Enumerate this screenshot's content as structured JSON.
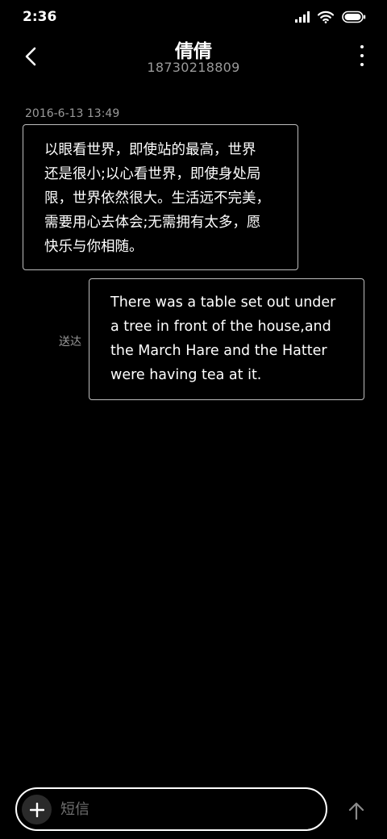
{
  "status_bar": {
    "time": "2:36",
    "icons": [
      "signal-icon",
      "wifi-icon",
      "battery-icon"
    ]
  },
  "header": {
    "contact_name": "倩倩",
    "phone_number": "18730218809",
    "icons": [
      "back-arrow-icon",
      "more-vertical-icon"
    ]
  },
  "conversation": {
    "timestamp": "2016-6-13 13:49",
    "messages": [
      {
        "direction": "incoming",
        "lines": [
          "以眼看世界，即使站的最高，世界",
          "还是很小;以心看世界，即使身处局",
          "限，世界依然很大。生活远不完美，",
          "需要用心去体会;无需拥有太多，愿",
          "快乐与你相随。"
        ]
      },
      {
        "direction": "outgoing",
        "status": "送达",
        "lines": [
          "There was a table set out under",
          "a tree in front of the house,and",
          "the March Hare and the Hatter",
          "were having tea at it."
        ]
      }
    ]
  },
  "input_bar": {
    "placeholder": "短信",
    "icons": [
      "plus-icon",
      "send-arrow-icon"
    ]
  },
  "colors": {
    "background": "#000000",
    "text": "#ffffff",
    "secondary_text": "#9a9a9a",
    "bubble_border": "#bdbdbd",
    "plus_button_bg": "#2a2a2a"
  }
}
